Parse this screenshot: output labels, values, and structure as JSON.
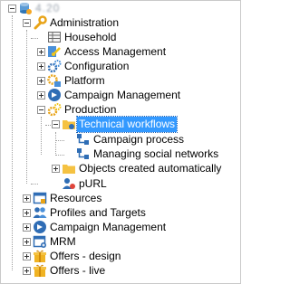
{
  "tree": {
    "root_label": "4.20",
    "admin": "Administration",
    "household": "Household",
    "access_management": "Access Management",
    "configuration": "Configuration",
    "platform": "Platform",
    "campaign_management_admin": "Campaign Management",
    "production": "Production",
    "technical_workflows": "Technical workflows",
    "campaign_process": "Campaign process",
    "managing_social_networks": "Managing social networks",
    "objects_created_automatically": "Objects created automatically",
    "purl": "pURL",
    "resources": "Resources",
    "profiles_and_targets": "Profiles and Targets",
    "campaign_management": "Campaign Management",
    "mrm": "MRM",
    "offers_design": "Offers - design",
    "offers_live": "Offers - live"
  },
  "selected_node": "Technical workflows"
}
